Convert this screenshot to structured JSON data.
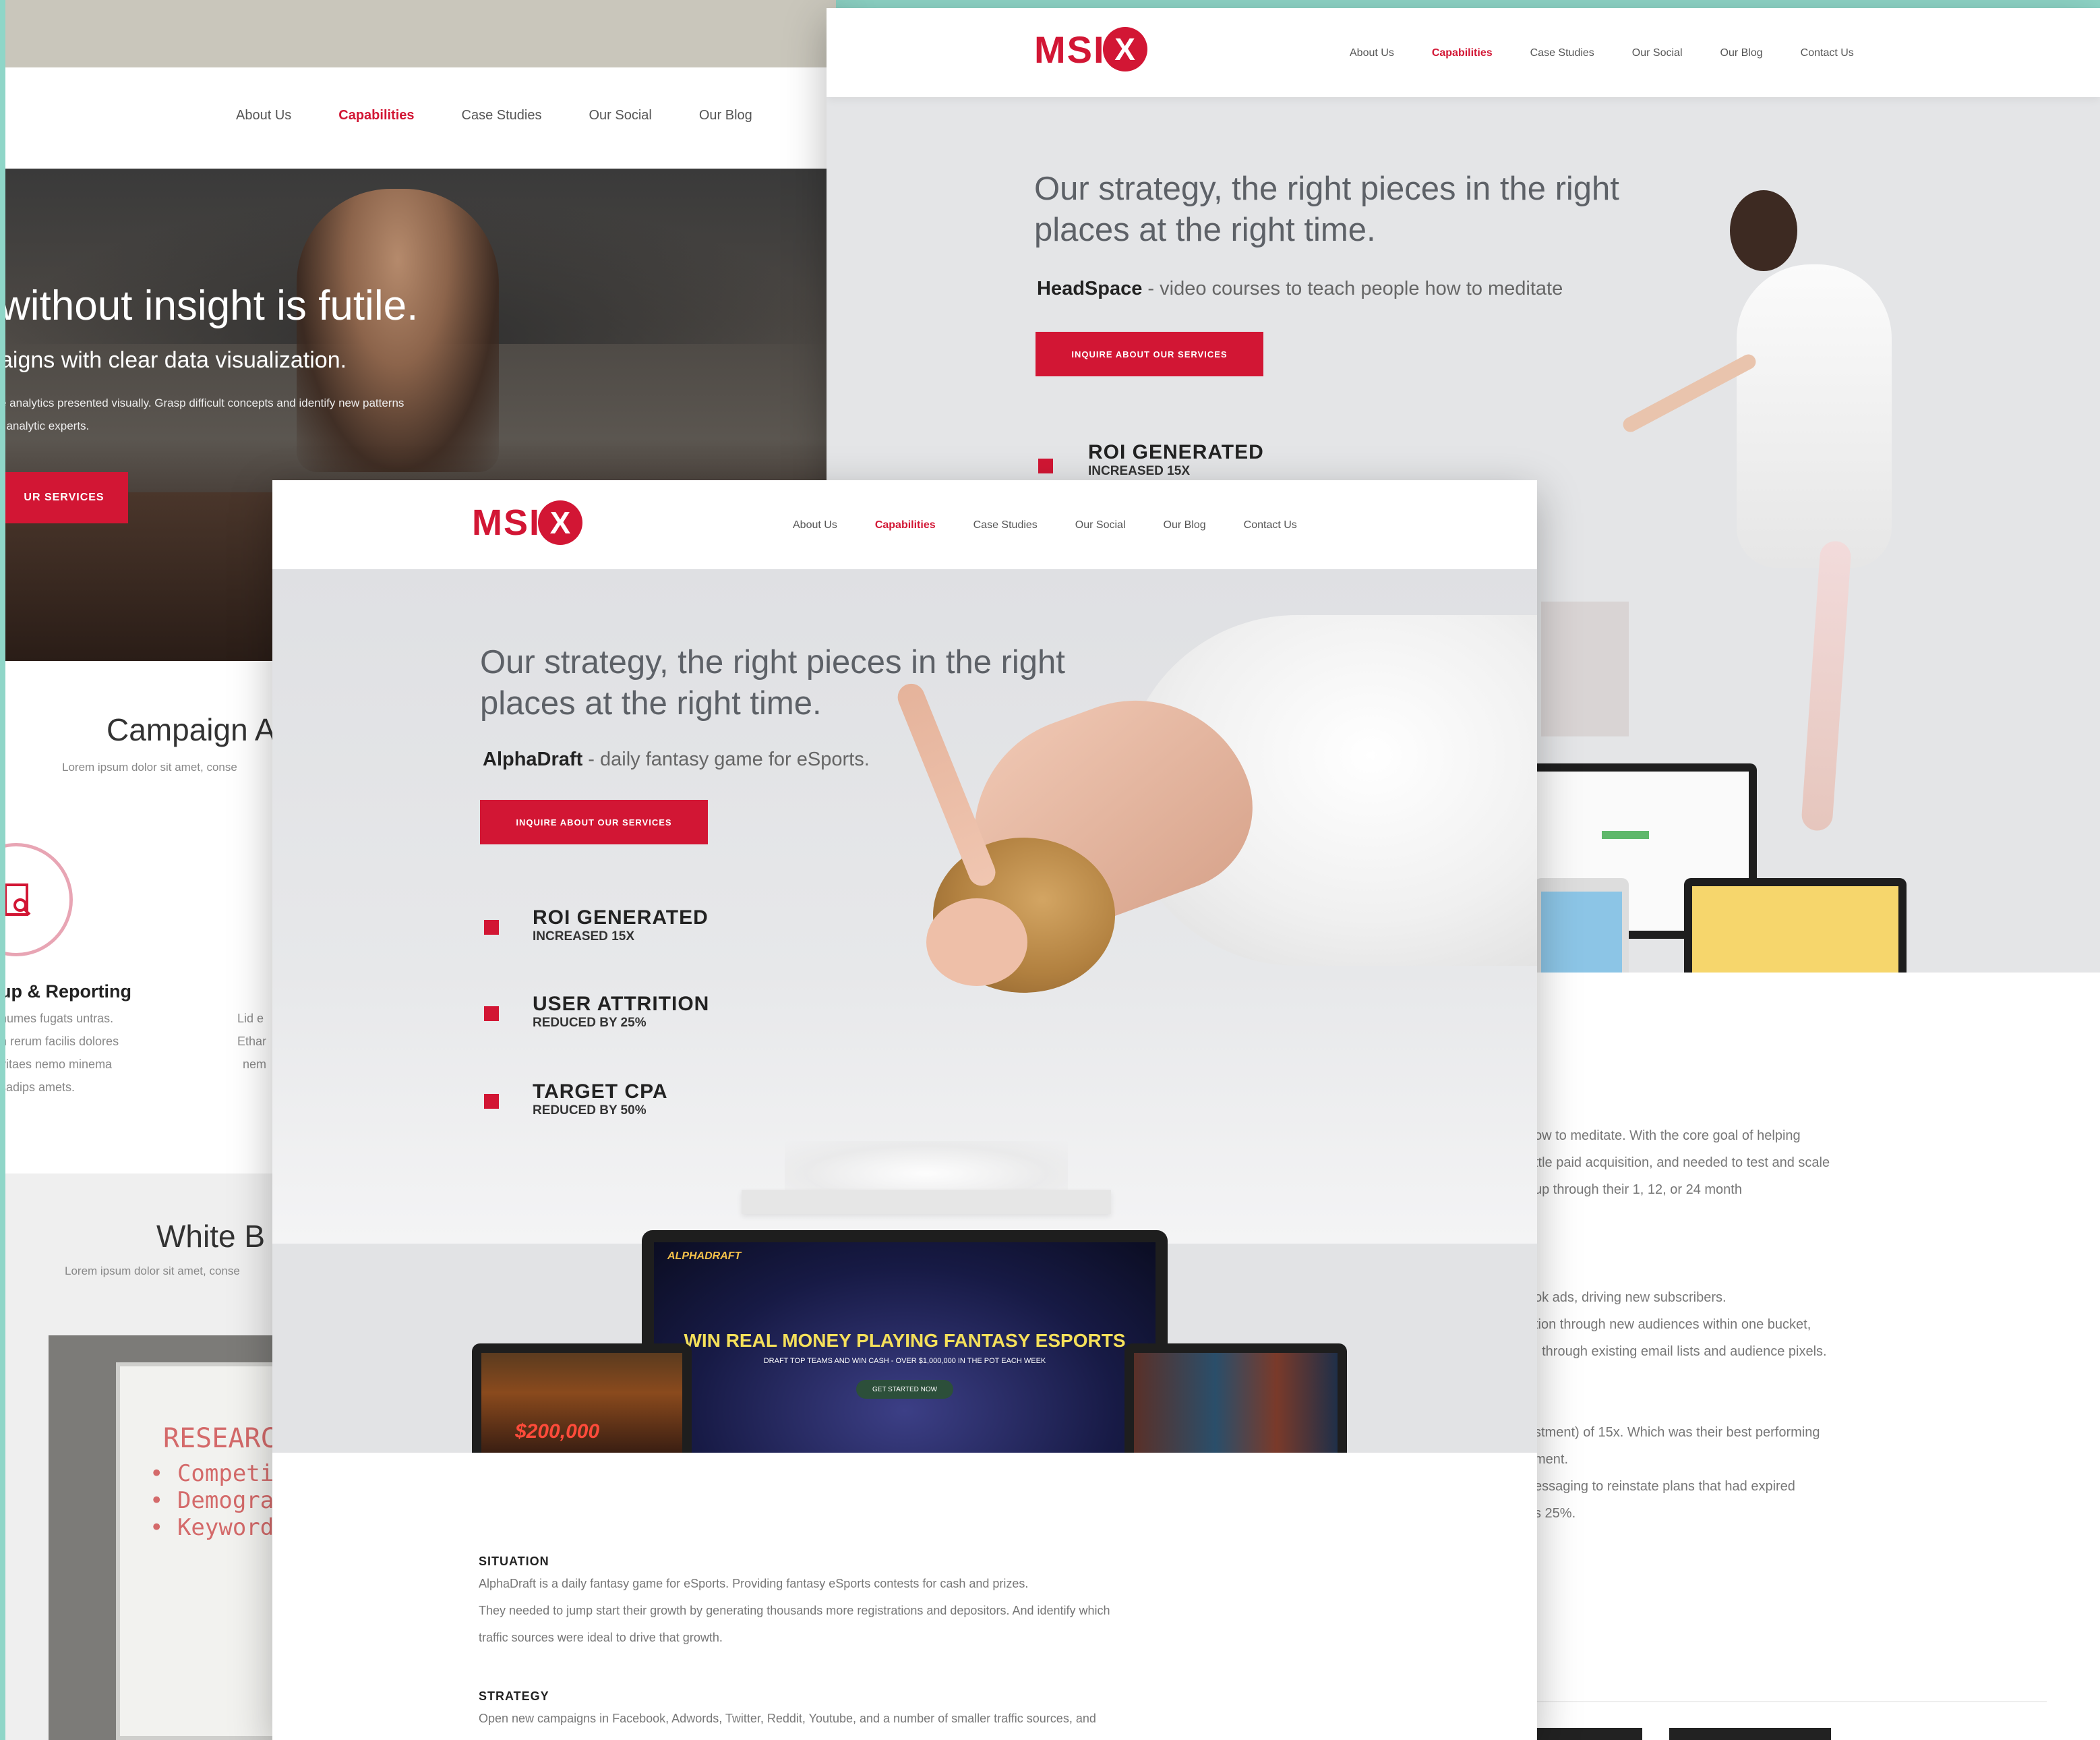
{
  "nav": {
    "items": [
      "About Us",
      "Capabilities",
      "Case Studies",
      "Our Social",
      "Our Blog",
      "Contact Us"
    ],
    "left_items": [
      "About Us",
      "Capabilities",
      "Case Studies",
      "Our Social",
      "Our Blog"
    ]
  },
  "logo": {
    "text": "MSI",
    "mark": "X"
  },
  "left_page": {
    "hero_title": "without insight is futile.",
    "hero_sub": "aigns with clear data visualization.",
    "hero_desc_1": "e analytics presented visually. Grasp difficult concepts  and identify new patterns",
    "hero_desc_2": "f analytic experts.",
    "hero_button": "UR SERVICES",
    "campaign_title": "Campaign A",
    "campaign_lorem": "Lorem ipsum dolor sit amet, conse",
    "feature_title": "up & Reporting",
    "feature_lines": [
      "numes fugats untras.",
      "n rerum facilis dolores",
      "vitaes nemo minema",
      "sadips amets."
    ],
    "feature2_lines": [
      "Lid e",
      "Ethar",
      "nem"
    ],
    "white_title": "White B",
    "white_lorem": "Lorem ipsum dolor sit amet, conse",
    "board_lines": [
      "RESEARC",
      "• Competitor",
      "• Demographi",
      "• Keyword"
    ]
  },
  "back_page": {
    "headline_1": "Our strategy, the right pieces in the right",
    "headline_2": "places at the right time.",
    "brand": "HeadSpace",
    "brand_desc": " - video courses to teach people how to meditate",
    "button": "INQUIRE ABOUT OUR SERVICES",
    "metric_title": "ROI GENERATED",
    "metric_sub": "INCREASED 15X",
    "text_lines": [
      "ow to meditate. With the core goal of helping",
      "ttle paid acquisition, and needed to test and scale",
      "up through their 1, 12, or 24 month",
      "ok ads, driving new subscribers.",
      "tion through new audiences within one bucket,",
      ", through existing email lists and audience pixels.",
      "stment) of 15x. Which was their best performing",
      "ment.",
      "essaging to reinstate plans that had expired",
      "s 25%."
    ]
  },
  "front_page": {
    "headline_1": "Our strategy, the right pieces in the right",
    "headline_2": "places at the right time.",
    "brand": "AlphaDraft",
    "brand_desc": " - daily fantasy game for eSports.",
    "button": "INQUIRE ABOUT OUR SERVICES",
    "metrics": [
      {
        "title": "ROI GENERATED",
        "sub": "INCREASED 15X"
      },
      {
        "title": "USER ATTRITION",
        "sub": "REDUCED BY 25%"
      },
      {
        "title": "TARGET CPA",
        "sub": "REDUCED BY 50%"
      }
    ],
    "device_brand": "ALPHADRAFT",
    "device_headline": "WIN REAL MONEY PLAYING FANTASY ESPORTS",
    "device_sub": "DRAFT TOP TEAMS AND WIN CASH - OVER $1,000,000 IN THE POT EACH WEEK",
    "device_button": "GET STARTED NOW",
    "device_left_amount": "$200,000",
    "situation_heading": "SITUATION",
    "situation_lines": [
      "AlphaDraft is a daily fantasy game for eSports. Providing fantasy eSports contests for cash and prizes.",
      "They needed to jump start their growth by generating thousands more registrations and depositors. And identify which",
      "traffic sources were ideal to drive that growth."
    ],
    "strategy_heading": "STRATEGY",
    "strategy_line": "Open new campaigns in Facebook, Adwords, Twitter, Reddit, Youtube, and a number of smaller traffic sources, and"
  },
  "colors": {
    "accent": "#d21634",
    "teal": "#8fd6c8"
  }
}
